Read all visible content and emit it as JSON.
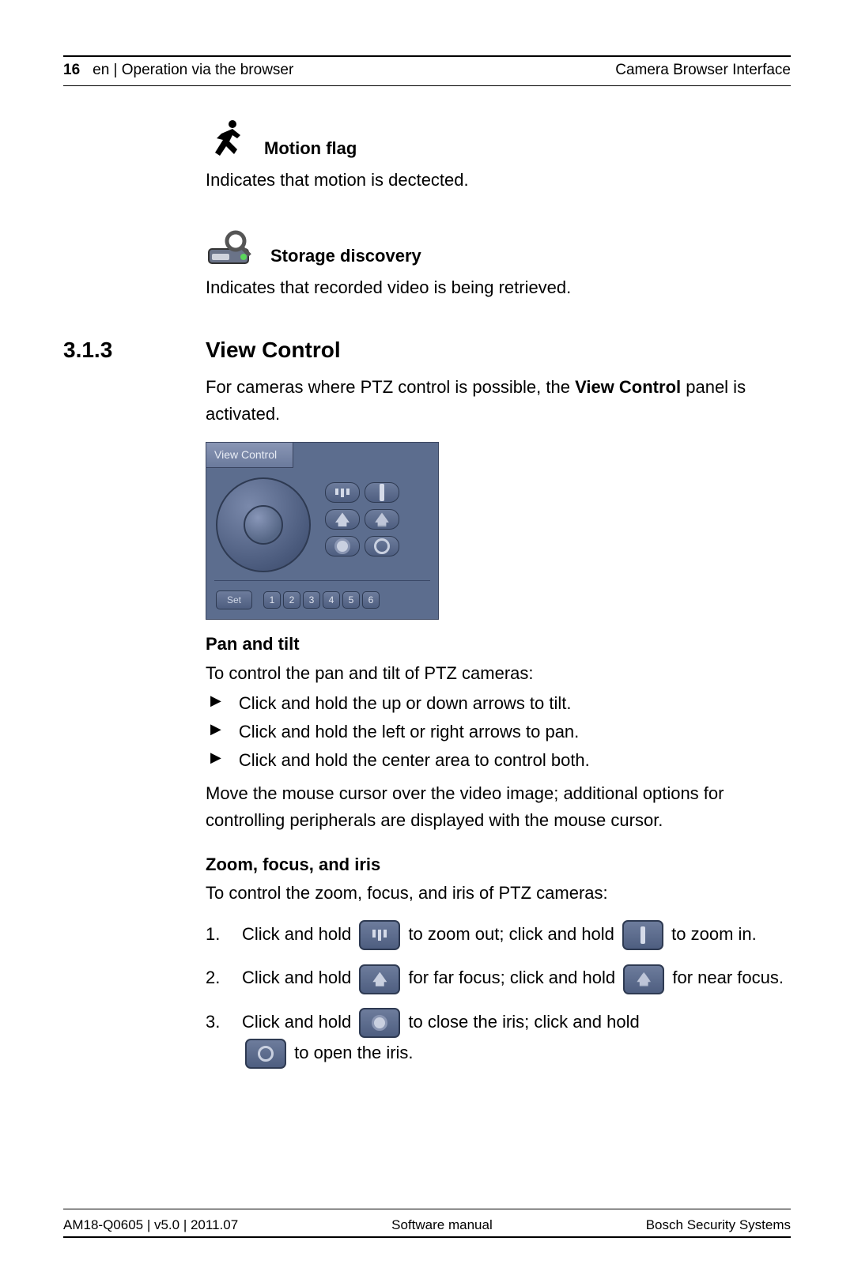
{
  "header": {
    "page_number": "16",
    "breadcrumb": "en | Operation via the browser",
    "doc_title": "Camera Browser Interface"
  },
  "motion": {
    "title": "Motion flag",
    "desc": "Indicates that motion is dectected."
  },
  "storage": {
    "title": "Storage discovery",
    "desc": "Indicates that recorded video is being retrieved."
  },
  "section": {
    "number": "3.1.3",
    "title": "View Control",
    "intro_pre": "For cameras where PTZ control is possible, the ",
    "intro_bold": "View Control",
    "intro_post": " panel is activated."
  },
  "view_control_panel": {
    "tab_label": "View Control",
    "set_label": "Set",
    "presets": [
      "1",
      "2",
      "3",
      "4",
      "5",
      "6"
    ]
  },
  "pan_tilt": {
    "heading": "Pan and tilt",
    "intro": "To control the pan and tilt of PTZ cameras:",
    "bullets": [
      "Click and hold the up or down arrows to tilt.",
      "Click and hold the left or right arrows to pan.",
      "Click and hold the center area to control both."
    ],
    "after": "Move the mouse cursor over the video image; additional options for controlling peripherals are displayed with the mouse cursor."
  },
  "zfi": {
    "heading": "Zoom, focus, and iris",
    "intro": "To control the zoom, focus, and iris of PTZ cameras:",
    "items": [
      {
        "num": "1.",
        "p1": "Click and hold ",
        "mid": " to zoom out; click and hold ",
        "tail": " to zoom in."
      },
      {
        "num": "2.",
        "p1": "Click and hold ",
        "mid": " for far focus; click and hold ",
        "tail": " for near focus."
      },
      {
        "num": "3.",
        "p1": "Click and hold ",
        "mid": " to close the iris; click and hold ",
        "tail": " to open the iris."
      }
    ]
  },
  "footer": {
    "left": "AM18-Q0605 | v5.0 | 2011.07",
    "center": "Software manual",
    "right": "Bosch Security Systems"
  }
}
